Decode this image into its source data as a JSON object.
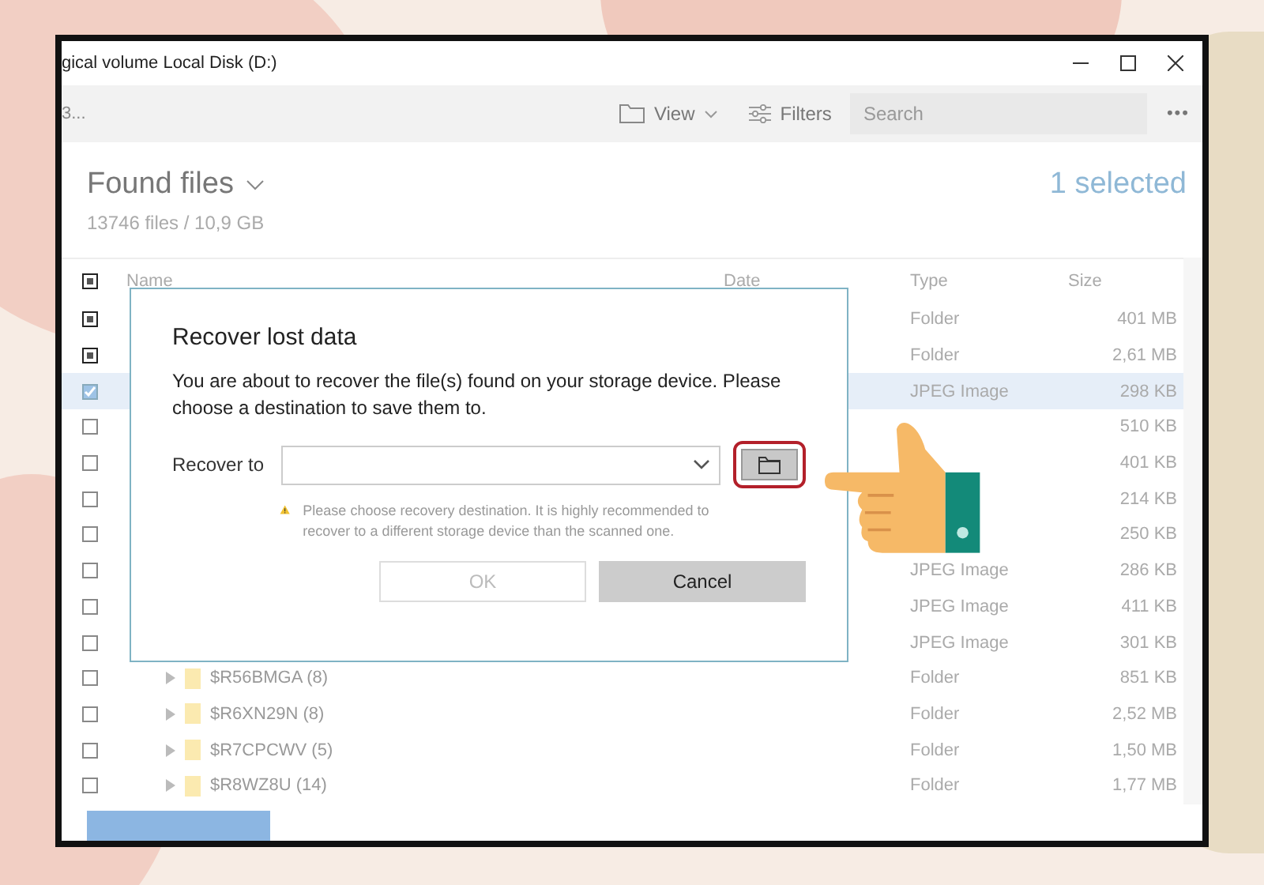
{
  "window": {
    "title": "gical volume Local Disk (D:)"
  },
  "toolbar": {
    "breadcrumb": "3...",
    "view_label": "View",
    "filters_label": "Filters",
    "search": {
      "placeholder": "Search"
    },
    "more": "•••"
  },
  "header": {
    "title": "Found files",
    "summary": "13746 files / 10,9 GB",
    "selection": "1 selected"
  },
  "table": {
    "header_checked": true,
    "header_partial": true,
    "columns": [
      "Name",
      "Date",
      "Type",
      "Size"
    ],
    "rows": [
      {
        "checked": true,
        "partial": true,
        "selected": false,
        "type": "Folder",
        "size": "401 MB"
      },
      {
        "checked": true,
        "partial": true,
        "selected": false,
        "type": "Folder",
        "size": "2,61 MB"
      },
      {
        "checked": true,
        "partial": false,
        "selected": true,
        "type": "JPEG Image",
        "size": "298 KB"
      },
      {
        "checked": false,
        "partial": false,
        "selected": false,
        "size": "510 KB"
      },
      {
        "checked": false,
        "partial": false,
        "selected": false,
        "size": "401 KB"
      },
      {
        "checked": false,
        "partial": false,
        "selected": false,
        "size": "214 KB"
      },
      {
        "checked": false,
        "partial": false,
        "selected": false,
        "size": "250 KB"
      },
      {
        "checked": false,
        "partial": false,
        "selected": false,
        "type": "JPEG Image",
        "size": "286 KB"
      },
      {
        "checked": false,
        "partial": false,
        "selected": false,
        "type": "JPEG Image",
        "size": "411 KB"
      },
      {
        "checked": false,
        "partial": false,
        "selected": false,
        "type": "JPEG Image",
        "size": "301 KB"
      },
      {
        "checked": false,
        "partial": false,
        "selected": false,
        "name": "$R56BMGA (8)",
        "type": "Folder",
        "size": "851 KB"
      },
      {
        "checked": false,
        "partial": false,
        "selected": false,
        "name": "$R6XN29N (8)",
        "type": "Folder",
        "size": "2,52 MB"
      },
      {
        "checked": false,
        "partial": false,
        "selected": false,
        "name": "$R7CPCWV (5)",
        "type": "Folder",
        "size": "1,50 MB"
      },
      {
        "checked": false,
        "partial": false,
        "selected": false,
        "name": "$R8WZ8U (14)",
        "type": "Folder",
        "size": "1,77 MB"
      }
    ]
  },
  "dialog": {
    "title": "Recover lost data",
    "message": "You are about to recover the file(s) found on your storage device. Please choose a destination to save them to.",
    "field_label": "Recover to",
    "warning": "Please choose recovery destination. It is highly recommended to recover to a different storage device than the scanned one.",
    "buttons": [
      {
        "label": "OK",
        "disabled": true
      },
      {
        "label": "Cancel",
        "disabled": false
      }
    ]
  }
}
